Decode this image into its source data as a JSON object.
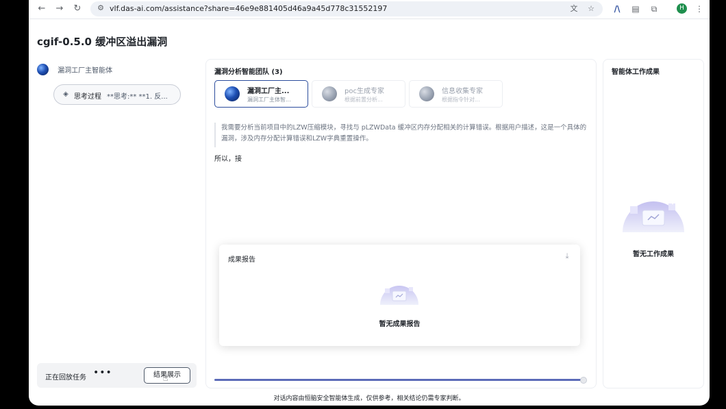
{
  "browser": {
    "url": "vlf.das-ai.com/assistance?share=46e9e881405d46a9a45d778c31552197",
    "back_icon": "arrow-left-icon",
    "forward_icon": "arrow-right-icon",
    "reload_icon": "reload-icon",
    "profile_initial": "H"
  },
  "page": {
    "title": "cgif-0.5.0 缓冲区溢出漏洞"
  },
  "left": {
    "agent_label": "漏洞工厂主智能体",
    "thinking_label": "思考过程",
    "thinking_preview": "**思考:** **1. 反...",
    "replay_label": "正在回放任务",
    "replay_dots": "•••",
    "result_button": "结果展示"
  },
  "center": {
    "header": "漏洞分析智能团队 (3)",
    "tabs": [
      {
        "name": "漏洞工厂主...",
        "desc": "漏洞工厂主体智..."
      },
      {
        "name": "poc生成专家",
        "desc": "根据前置分析..."
      },
      {
        "name": "信息收集专家",
        "desc": "根据指令针对..."
      }
    ],
    "quote": "我需要分析当前项目中的LZW压缩模块，寻找与 pLZWData 缓冲区内存分配相关的计算错误。根据用户描述，这是一个具体的漏洞，涉及内存分配计算错误和LZW字典重置操作。",
    "paragraph": "所以，接"
  },
  "report": {
    "title": "成果报告",
    "empty_text": "暂无成果报告"
  },
  "right": {
    "header": "智能体工作成果",
    "empty_text": "暂无工作成果"
  },
  "footer": "对话内容由恒脑安全智能体生成，仅供参考，相关结论仍需专家判断。",
  "colors": {
    "accent": "#2b4c9c",
    "progress": "#5b6bb8"
  }
}
